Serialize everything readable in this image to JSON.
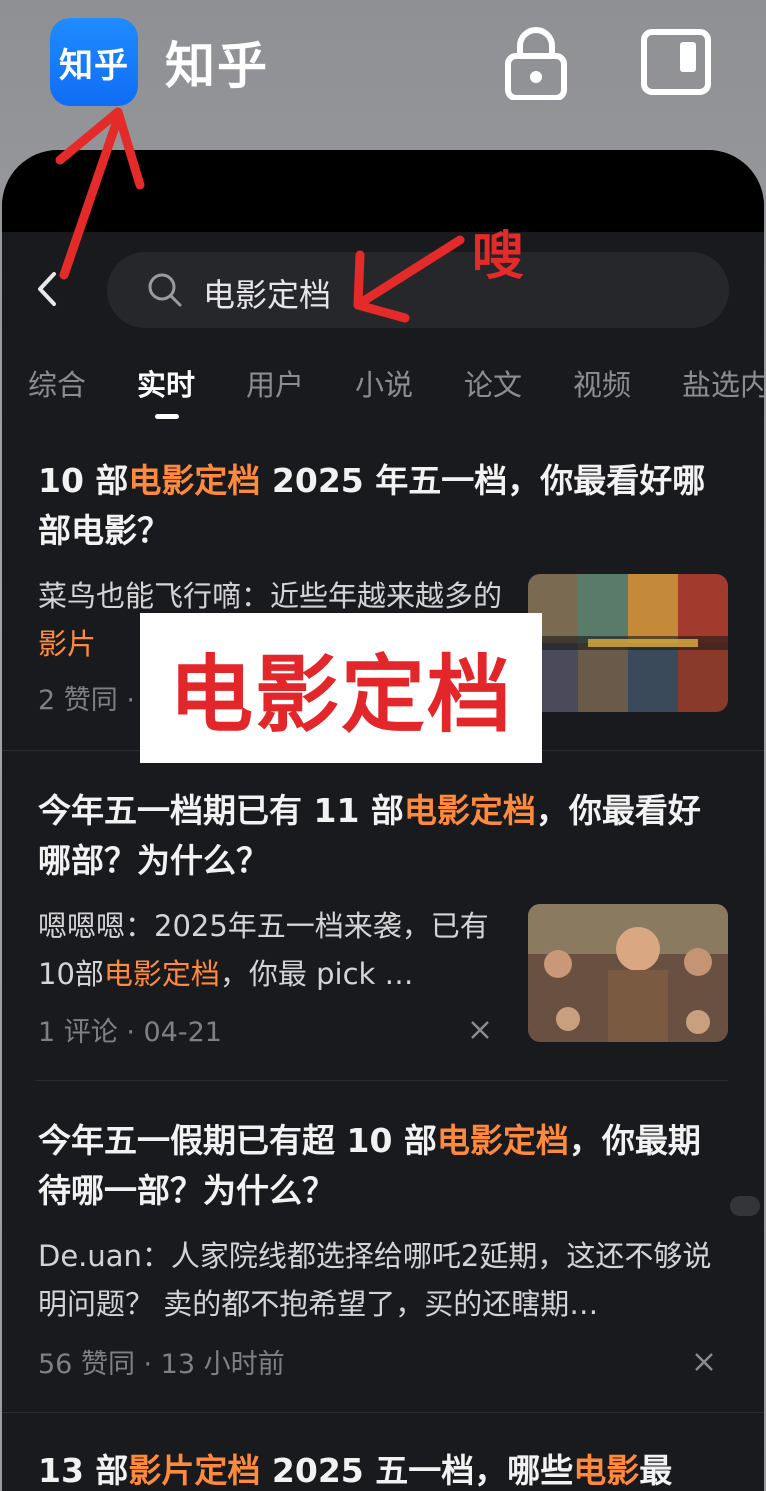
{
  "app": {
    "icon_text": "知乎",
    "name": "知乎"
  },
  "search": {
    "query": "电影定档"
  },
  "tabs": [
    {
      "label": "综合"
    },
    {
      "label": "实时",
      "active": true
    },
    {
      "label": "用户"
    },
    {
      "label": "小说"
    },
    {
      "label": "论文"
    },
    {
      "label": "视频"
    },
    {
      "label": "盐选内"
    }
  ],
  "results": [
    {
      "title_parts": [
        "10 部",
        "电影定档",
        " 2025 年五一档，你最看好哪部电影？"
      ],
      "snippet_parts": [
        "菜鸟也能飞行嘀：近些年越来越多的",
        "影片"
      ],
      "meta": "2 赞同 ·"
    },
    {
      "title_parts": [
        "今年五一档期已有 11 部",
        "电影定档",
        "，你最看好哪部？为什么？"
      ],
      "snippet_parts": [
        "嗯嗯嗯：2025年五一档来袭，已有10部",
        "电影定档",
        "，你最 pick …"
      ],
      "meta": "1 评论 · 04-21"
    },
    {
      "title_parts": [
        "今年五一假期已有超 10 部",
        "电影定档",
        "，你最期待哪一部？为什么？"
      ],
      "snippet": "De.uan：人家院线都选择给哪吒2延期，这还不够说明问题？ 卖的都不抱希望了，买的还瞎期…",
      "meta": "56 赞同 · 13 小时前"
    },
    {
      "title_parts": [
        "13 部",
        "影片定档",
        " 2025 五一档，哪些",
        "电影",
        "最"
      ]
    }
  ],
  "annotations": {
    "label_box": "电影定档",
    "sou": "嗖",
    "arrow_color": "#e52a2a"
  },
  "colors": {
    "highlight": "#ff8a3d",
    "background": "#191a1d",
    "accent_brand": "#1f8cff"
  }
}
